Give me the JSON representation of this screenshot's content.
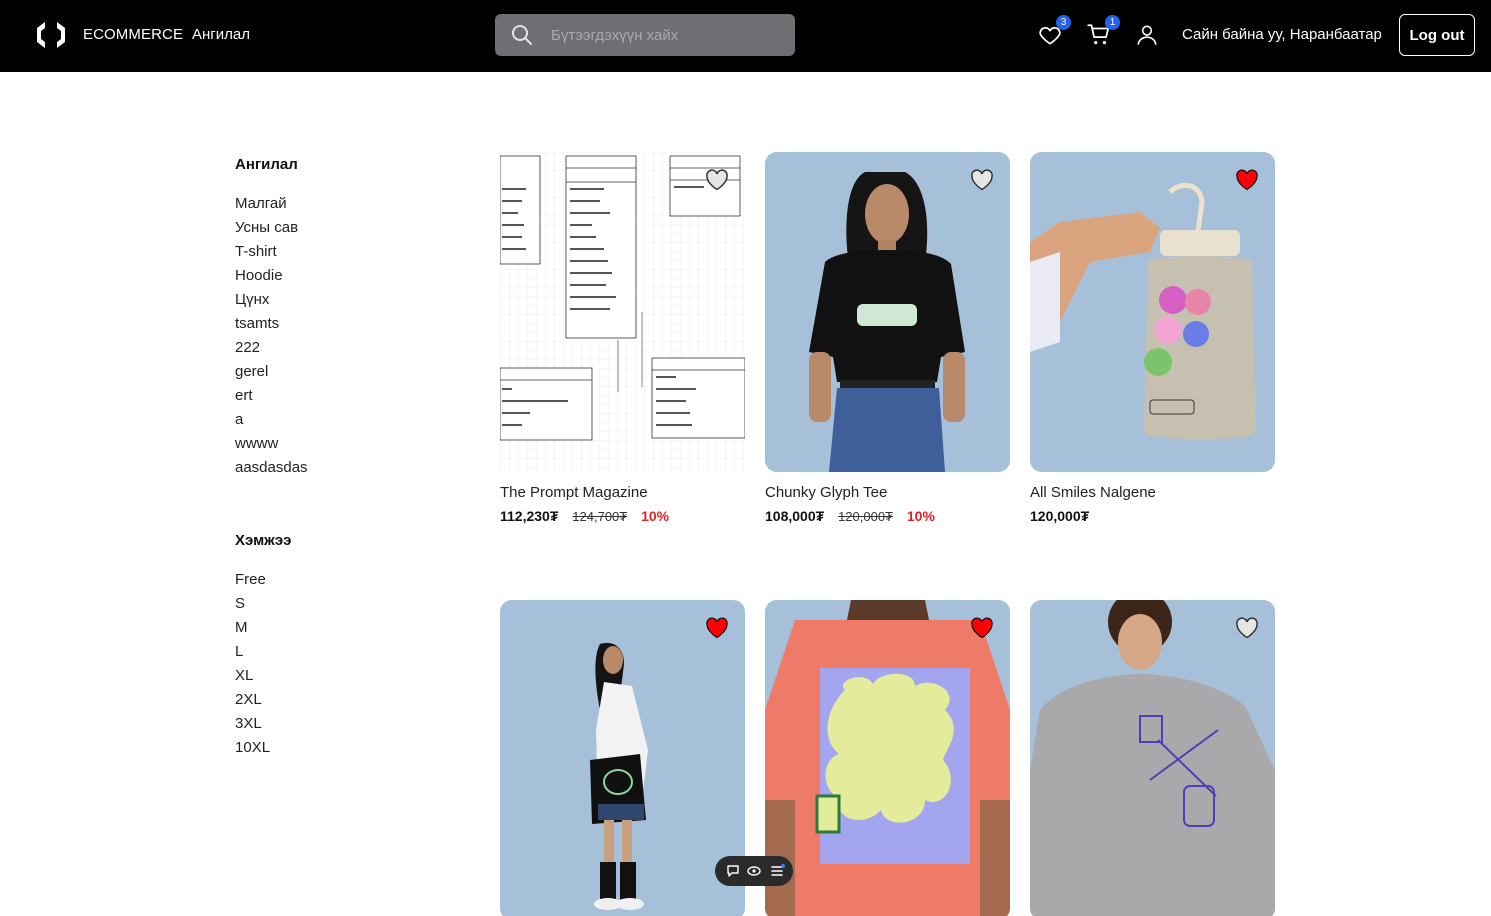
{
  "header": {
    "brand": "ECOMMERCE",
    "nav_category": "Ангилал",
    "search_placeholder": "Бүтээгдэхүүн хайх",
    "wishlist_count": "3",
    "cart_count": "1",
    "greeting": "Сайн байна уу, Наранбаатар",
    "logout_label": "Log out"
  },
  "sidebar": {
    "category_title": "Ангилал",
    "categories": [
      "Малгай",
      "Усны сав",
      "T-shirt",
      "Hoodie",
      "Цүнх",
      "tsamts",
      "222",
      "gerel",
      "ert",
      "a",
      "wwww",
      "aasdasdas"
    ],
    "size_title": "Хэмжээ",
    "sizes": [
      "Free",
      "S",
      "M",
      "L",
      "XL",
      "2XL",
      "3XL",
      "10XL"
    ]
  },
  "products": [
    {
      "name": "The Prompt Magazine",
      "price": "112,230₮",
      "old_price": "124,700₮",
      "discount": "10%",
      "liked": false
    },
    {
      "name": "Chunky Glyph Tee",
      "price": "108,000₮",
      "old_price": "120,000₮",
      "discount": "10%",
      "liked": false
    },
    {
      "name": "All Smiles Nalgene",
      "price": "120,000₮",
      "old_price": "",
      "discount": "",
      "liked": true
    },
    {
      "name": "",
      "price": "",
      "old_price": "",
      "discount": "",
      "liked": true
    },
    {
      "name": "",
      "price": "",
      "old_price": "",
      "discount": "",
      "liked": true
    },
    {
      "name": "",
      "price": "",
      "old_price": "",
      "discount": "",
      "liked": false
    }
  ],
  "colors": {
    "header_bg": "#000000",
    "badge": "#2563eb",
    "discount": "#e02424",
    "heart_liked": "#ff0000",
    "photo_bg": "#a9c3db"
  }
}
